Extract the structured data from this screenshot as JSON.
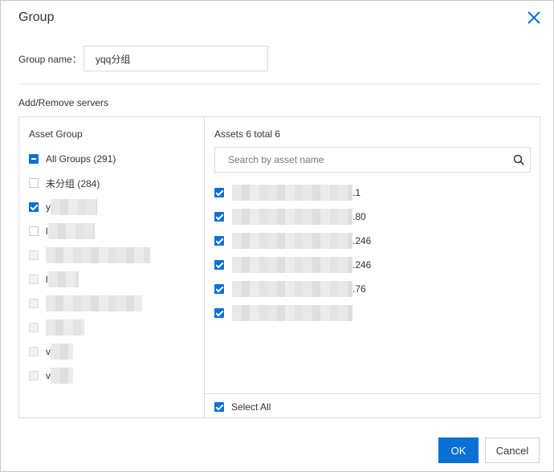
{
  "dialog": {
    "title": "Group",
    "group_name_label": "Group name：",
    "group_name_value": "yqq分组",
    "section_label": "Add/Remove servers",
    "ok_label": "OK",
    "cancel_label": "Cancel"
  },
  "left_panel": {
    "title": "Asset Group",
    "items": [
      {
        "label": "All Groups (291)",
        "state": "indeterminate"
      },
      {
        "label": "未分组 (284)",
        "state": "unchecked"
      },
      {
        "label": "y",
        "state": "checked"
      },
      {
        "label": "l",
        "state": "unchecked"
      },
      {
        "label": "",
        "state": "disabled"
      },
      {
        "label": "l",
        "state": "disabled"
      },
      {
        "label": "",
        "state": "disabled"
      },
      {
        "label": "",
        "state": "disabled"
      },
      {
        "label": "v",
        "state": "disabled"
      },
      {
        "label": "v",
        "state": "disabled"
      }
    ]
  },
  "right_panel": {
    "title": "Assets 6 total 6",
    "search_placeholder": "Search by asset name",
    "assets": [
      {
        "suffix": ".1",
        "checked": true
      },
      {
        "suffix": ".80",
        "checked": true
      },
      {
        "suffix": ".246",
        "checked": true
      },
      {
        "suffix": ".246",
        "checked": true
      },
      {
        "suffix": ".76",
        "checked": true
      },
      {
        "suffix": "",
        "checked": true
      }
    ],
    "select_all_label": "Select All",
    "select_all_checked": true
  },
  "colors": {
    "accent": "#0a70d4",
    "border": "#dcdcdc"
  }
}
